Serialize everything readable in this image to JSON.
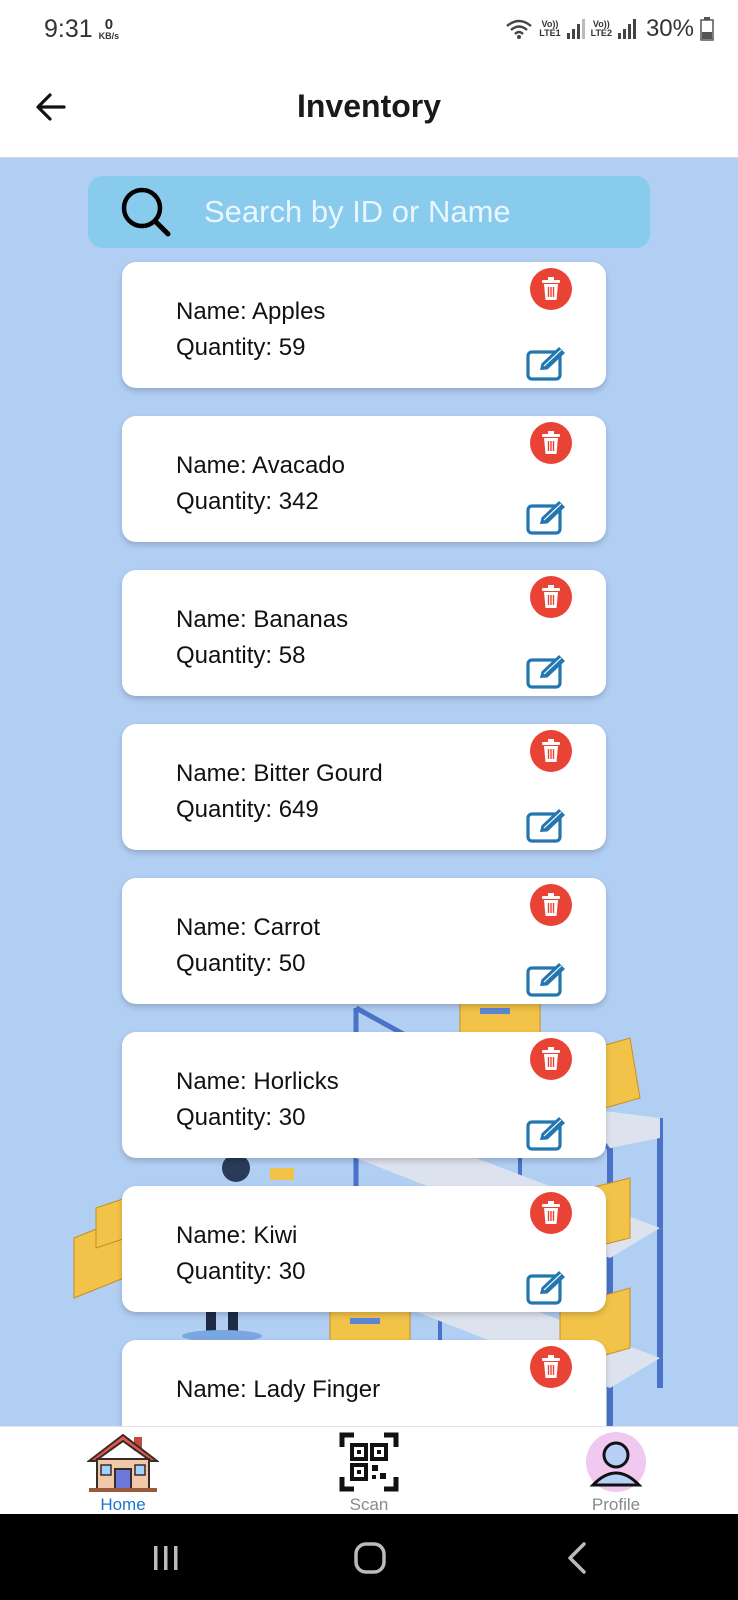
{
  "status_bar": {
    "time": "9:31",
    "net_speed_value": "0",
    "net_speed_unit": "KB/s",
    "sim1_label_top": "Vo))",
    "sim1_label_bottom": "LTE1",
    "sim2_label_top": "Vo))",
    "sim2_label_bottom": "LTE2",
    "battery": "30%",
    "icons": [
      "wifi-icon",
      "signal-icon",
      "signal-icon",
      "battery-icon"
    ]
  },
  "header": {
    "title": "Inventory",
    "back_icon": "arrow-left-icon"
  },
  "search": {
    "placeholder": "Search by ID or Name",
    "value": "",
    "icon": "search-icon"
  },
  "items": [
    {
      "name_line": "Name: Apples",
      "qty_line": "Quantity: 59"
    },
    {
      "name_line": "Name: Avacado",
      "qty_line": "Quantity: 342"
    },
    {
      "name_line": "Name: Bananas",
      "qty_line": "Quantity: 58"
    },
    {
      "name_line": "Name: Bitter Gourd",
      "qty_line": "Quantity: 649"
    },
    {
      "name_line": "Name: Carrot",
      "qty_line": "Quantity: 50"
    },
    {
      "name_line": "Name: Horlicks",
      "qty_line": "Quantity: 30"
    },
    {
      "name_line": "Name: Kiwi",
      "qty_line": "Quantity: 30"
    },
    {
      "name_line": "Name: Lady Finger",
      "qty_line": ""
    }
  ],
  "bottom_nav": {
    "home_label": "Home",
    "scan_label": "Scan",
    "profile_label": "Profile",
    "active": "Home"
  },
  "colors": {
    "content_bg": "#b1cef3",
    "search_bg": "#88cbec",
    "delete": "#e94336",
    "edit": "#2476b0",
    "active_nav": "#1b76d2"
  }
}
